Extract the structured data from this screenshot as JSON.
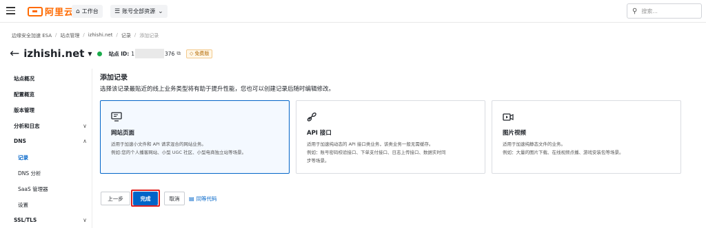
{
  "topbar": {
    "logo_text": "阿里云",
    "workbench_label": "工作台",
    "resources_label": "账号全部资源",
    "search_placeholder": "搜索..."
  },
  "breadcrumb": [
    "边缘安全加速 ESA",
    "站点管理",
    "izhishi.net",
    "记录",
    "添加记录"
  ],
  "header": {
    "site_name": "izhishi.net",
    "site_id_label": "站点 ID:",
    "site_id_prefix": "1",
    "site_id_suffix": "376",
    "plan_badge": "免费版"
  },
  "sidebar": {
    "items": [
      {
        "label": "站点概况"
      },
      {
        "label": "配置概览"
      },
      {
        "label": "版本管理"
      },
      {
        "label": "分析和日志",
        "chevron": "down"
      },
      {
        "label": "DNS",
        "chevron": "up"
      },
      {
        "label": "记录",
        "active": true
      },
      {
        "label": "DNS 分析"
      },
      {
        "label": "SaaS 管理器"
      },
      {
        "label": "设置"
      },
      {
        "label": "SSL/TLS",
        "chevron": "down"
      }
    ]
  },
  "main": {
    "title": "添加记录",
    "description": "选择该记录最贴近的线上业务类型将有助于提升性能，您也可以创建记录后随时编辑修改。",
    "cards": [
      {
        "title": "网站页面",
        "icon": "monitor-icon",
        "lines": [
          "适用于加速小文件和 API 请求混合的网站业务。",
          "例如:您的个人播客网站、小型 UGC 社区、小型电商独立站等场景。"
        ]
      },
      {
        "title": "API 接口",
        "icon": "link-icon",
        "lines": [
          "适用于加速纯动态的 API 接口类业务，该类业务一般无需缓存。",
          "例如：账号密码校验接口、下单支付接口、日志上传接口、数据实时同",
          "步等场景。"
        ]
      },
      {
        "title": "图片视频",
        "icon": "media-icon",
        "lines": [
          "适用于加速纯静态文件的业务。",
          "例如：大量的图片下载、在线视频点播、游戏安装包等场景。"
        ]
      }
    ]
  },
  "actions": {
    "prev_label": "上一步",
    "done_label": "完成",
    "cancel_label": "取消",
    "code_label": "同等代码"
  },
  "colors": {
    "brand": "#ff6a00",
    "primary": "#0064c8",
    "highlight": "#e0201f",
    "success": "#1aab4b"
  }
}
